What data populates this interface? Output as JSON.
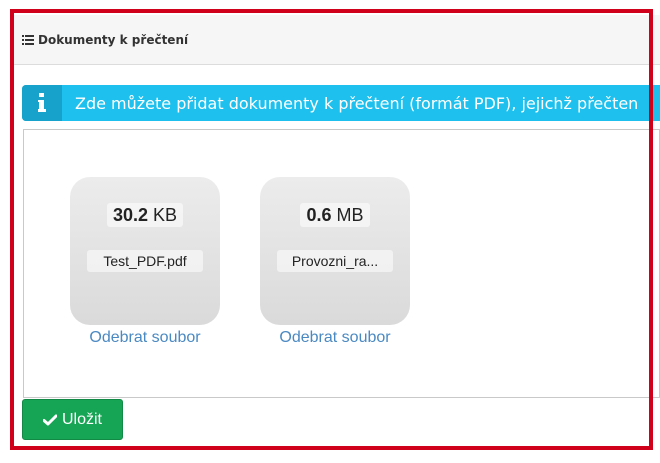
{
  "panel": {
    "title": "Dokumenty k přečtení",
    "icon": "list-icon"
  },
  "info_banner": {
    "text": "Zde můžete přidat dokumenty k přečtení (formát PDF), jejichž přečten",
    "icon": "info-icon",
    "color": "#1ec0ee"
  },
  "files": [
    {
      "size_value": "30.2",
      "size_unit": "KB",
      "name": "Test_PDF.pdf",
      "remove_label": "Odebrat soubor"
    },
    {
      "size_value": "0.6",
      "size_unit": "MB",
      "name": "Provozni_ra...",
      "remove_label": "Odebrat soubor"
    }
  ],
  "save_button": {
    "label": "Uložit",
    "icon": "check-icon",
    "color": "#15a554"
  },
  "colors": {
    "highlight": "#d0021b",
    "link": "#4a89c2"
  }
}
